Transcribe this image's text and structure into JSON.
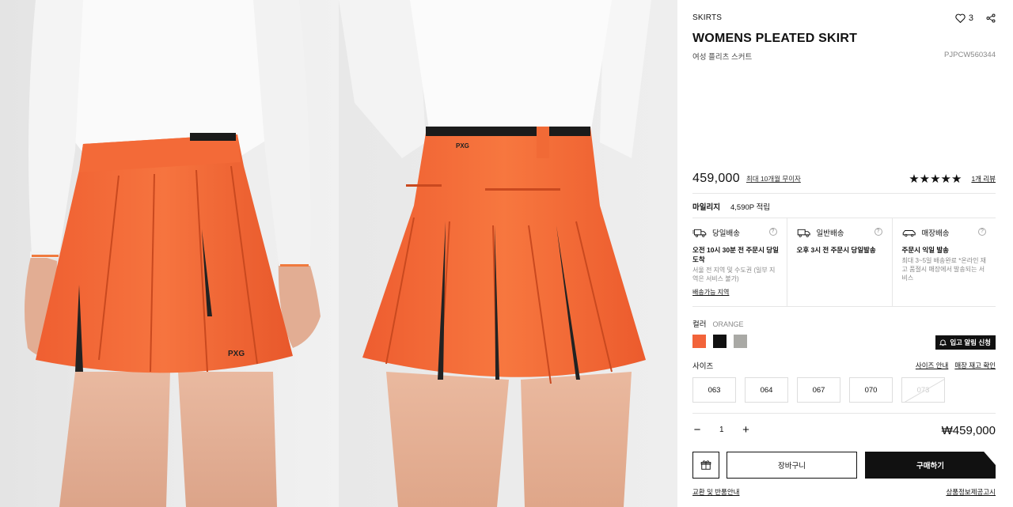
{
  "product": {
    "category": "SKIRTS",
    "title": "WOMENS PLEATED SKIRT",
    "subtitle": "여성 플리츠 스커트",
    "code": "PJPCW560344",
    "wish_count": "3"
  },
  "price": {
    "amount": "459,000",
    "installment": "최대 10개월 무이자",
    "stars": "★★★★★",
    "rating": 5,
    "review_link": "1개 리뷰"
  },
  "mileage": {
    "label": "마일리지",
    "value": "4,590P 적립"
  },
  "delivery": [
    {
      "icon": "truck-fast-icon",
      "title": "당일배송",
      "bold": "오전 10시 30분 전 주문시 당일도착",
      "small": "서울 전 지역 및 수도권 (일부 지역은 서비스 불가)",
      "link": "배송가능 지역"
    },
    {
      "icon": "truck-icon",
      "title": "일반배송",
      "bold": "오후 3시 전 주문시 당일발송",
      "small": "",
      "link": ""
    },
    {
      "icon": "car-icon",
      "title": "매장배송",
      "bold": "주문시 익일 발송",
      "small": "최대 3~5일 배송완료 *온라인 재고 품절시 매장에서 발송되는 서비스",
      "link": ""
    }
  ],
  "color": {
    "label": "컬러",
    "selected": "ORANGE",
    "swatches": [
      "#f2633a",
      "#111111",
      "#a9a9a5"
    ]
  },
  "restock_button": "입고 알림 신청",
  "size": {
    "label": "사이즈",
    "guide": "사이즈 안내",
    "store_stock": "매장 재고 확인",
    "options": [
      "063",
      "064",
      "067",
      "070",
      "073"
    ],
    "soldout": [
      "073"
    ]
  },
  "order": {
    "quantity": "1",
    "minus": "−",
    "plus": "+",
    "total": "₩459,000",
    "cart_label": "장바구니",
    "buy_label": "구매하기"
  },
  "footer": {
    "exchange": "교환 및 반품안내",
    "notice": "상품정보제공고시"
  }
}
